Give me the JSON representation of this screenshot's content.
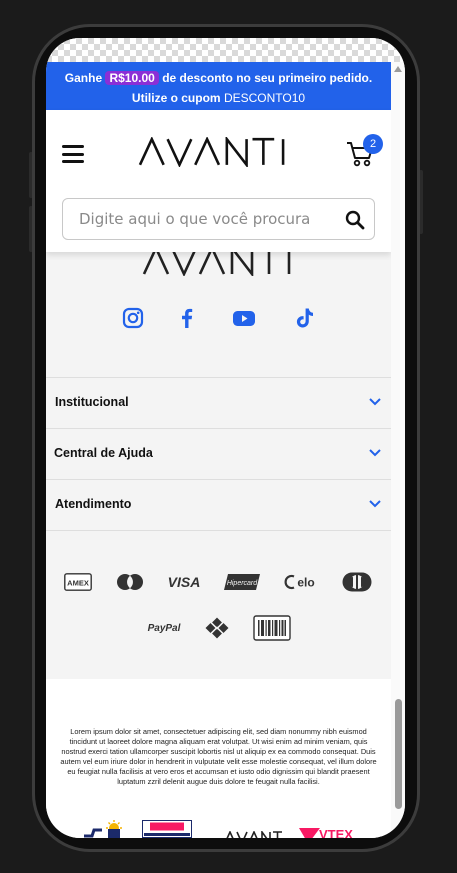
{
  "promo": {
    "prefix": "Ganhe",
    "amount": "R$10.00",
    "middle": "de desconto no seu primeiro pedido.",
    "coupon_prefix": "Utilize o cupom",
    "coupon_code": "DESCONTO10"
  },
  "header": {
    "logo_text": "AVANTI",
    "cart_count": "2",
    "menu_icon": "hamburger-icon",
    "cart_icon": "cart-icon"
  },
  "search": {
    "placeholder": "Digite aqui o que você procura",
    "value": "",
    "icon": "search-icon"
  },
  "footer": {
    "logo_text": "AVANTI",
    "socials": [
      "instagram-icon",
      "facebook-icon",
      "youtube-icon",
      "tiktok-icon"
    ],
    "accordion": [
      {
        "label": "Institucional"
      },
      {
        "label": "Central de Ajuda"
      },
      {
        "label": "Atendimento"
      }
    ],
    "payment_row1": [
      "AMEX",
      "mastercard",
      "VISA",
      "Hipercard",
      "elo",
      "diners"
    ],
    "payment_row2": [
      "PayPal",
      "pix",
      "boleto"
    ],
    "lorem": "Lorem ipsum dolor sit amet, consectetuer adipiscing elit, sed diam nonummy nibh euismod tincidunt ut laoreet dolore magna aliquam erat volutpat. Ut wisi enim ad minim veniam, quis nostrud exerci tation ullamcorper suscipit lobortis nisl ut aliquip ex ea commodo consequat. Duis autem vel eum iriure dolor in hendrerit in vulputate velit esse molestie consequat, vel illum dolore eu feugiat nulla facilisis at vero eros et accumsan et iusto odio dignissim qui blandit praesent luptatum zzril delenit augue duis dolore te feugait nulla facilisi."
  },
  "colors": {
    "accent": "#2262ea",
    "coupon_pill": "#8b2fd6",
    "vtex_pink": "#f71963"
  }
}
